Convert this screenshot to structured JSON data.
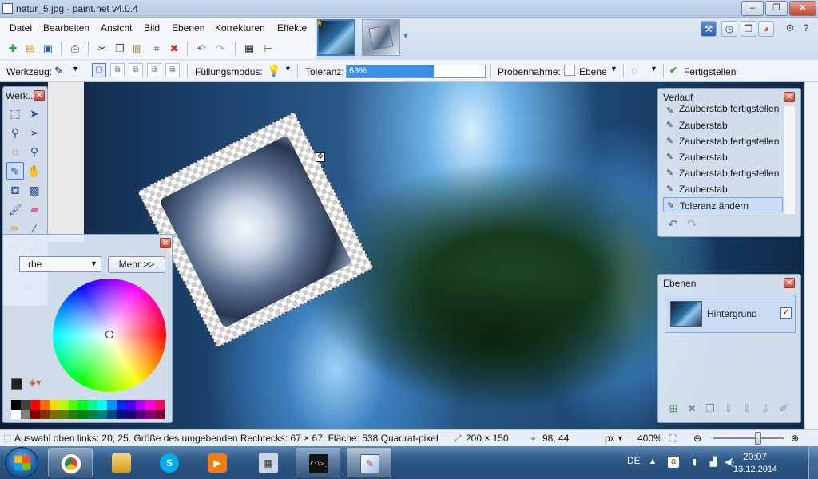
{
  "window": {
    "title": "natur_5.jpg - paint.net v4.0.4",
    "controls": {
      "minimize": "–",
      "maximize": "❐",
      "close": "✕"
    }
  },
  "menu": [
    "Datei",
    "Bearbeiten",
    "Ansicht",
    "Bild",
    "Ebenen",
    "Korrekturen",
    "Effekte"
  ],
  "toolbar": {
    "tool_label": "Werkzeug:",
    "fill_mode_label": "Füllungsmodus:",
    "tolerance_label": "Toleranz:",
    "tolerance_value": "63%",
    "tolerance_fraction": 0.63,
    "sampling_label": "Probennahme:",
    "sampling_value": "Ebene",
    "finish_label": "Fertigstellen"
  },
  "panels": {
    "tools_title": "Werk...",
    "colors": {
      "select_value": "rbe",
      "more_button": "Mehr >>"
    },
    "history": {
      "title": "Verlauf",
      "items": [
        "Zauberstab fertigstellen",
        "Zauberstab",
        "Zauberstab fertigstellen",
        "Zauberstab",
        "Zauberstab fertigstellen",
        "Zauberstab",
        "Toleranz ändern"
      ],
      "selected_index": 6
    },
    "layers": {
      "title": "Ebenen",
      "layer_name": "Hintergrund",
      "visible_check": "✓"
    }
  },
  "status": {
    "selection": "Auswahl oben links: 20, 25. Größe des umgebenden Rechtecks: 67 × 67. Fläche: 538 Quadrat-pixel",
    "image_size": "200 × 150",
    "cursor_pos": "98, 44",
    "unit": "px",
    "zoom": "400%",
    "zoom_slider_fraction": 0.6
  },
  "taskbar": {
    "language": "DE",
    "time": "20:07",
    "date": "13.12.2014",
    "cmd_label": "C:\\>_"
  },
  "colors": {
    "accent": "#3c8ee3",
    "title_bar": "#c9daf0",
    "taskbar": "#2f5987"
  }
}
